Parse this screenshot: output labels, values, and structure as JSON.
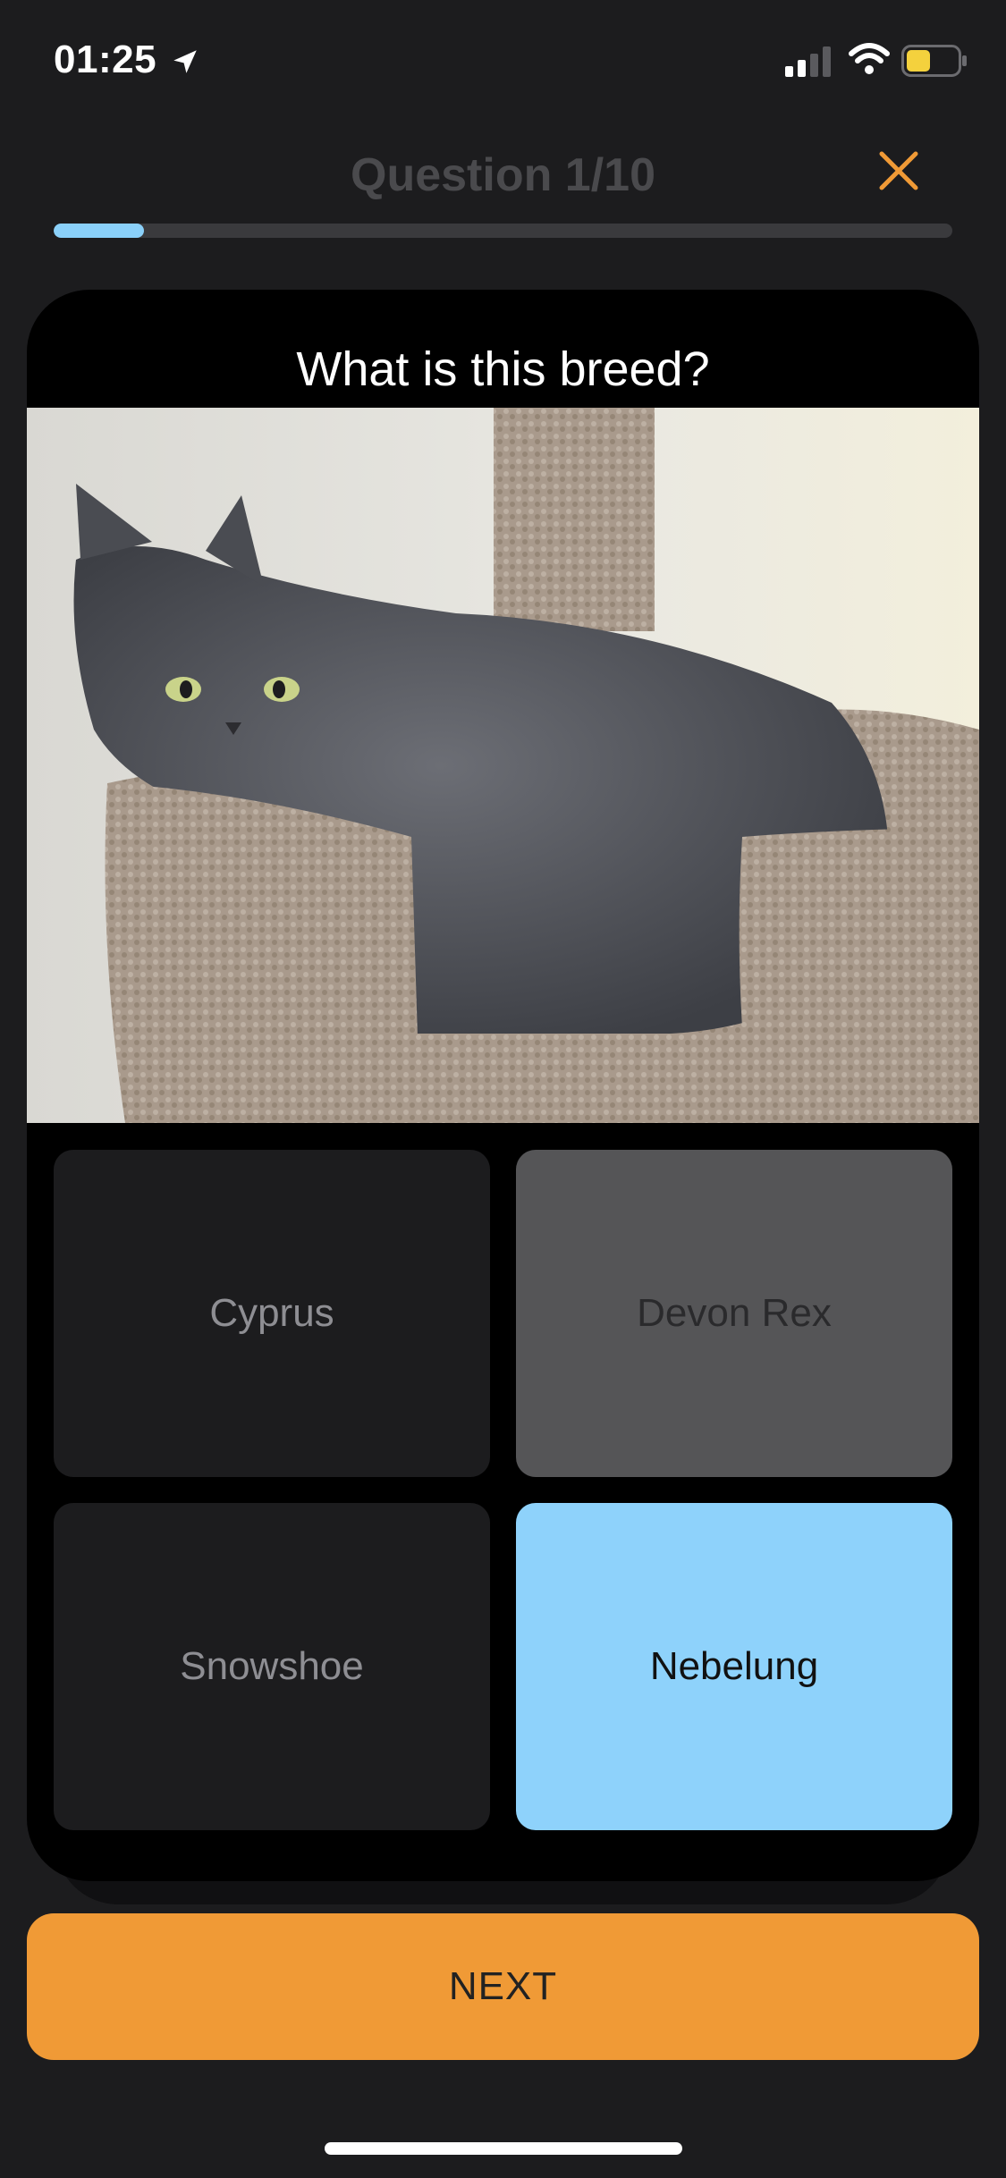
{
  "status_bar": {
    "time": "01:25",
    "location_icon": "location-arrow-icon",
    "signal_icon": "cellular-signal-icon",
    "wifi_icon": "wifi-icon",
    "battery_icon": "battery-icon"
  },
  "header": {
    "title": "Question 1/10",
    "close_icon": "close-icon",
    "progress_fraction": 0.1,
    "progress_color": "#8ad0f9"
  },
  "card": {
    "question": "What is this breed?",
    "image_icon": "cat-photo"
  },
  "answers": [
    {
      "label": "Cyprus",
      "state": "default"
    },
    {
      "label": "Devon Rex",
      "state": "disabled"
    },
    {
      "label": "Snowshoe",
      "state": "default"
    },
    {
      "label": "Nebelung",
      "state": "selected"
    }
  ],
  "footer": {
    "next_label": "NEXT",
    "accent": "#f09a36"
  }
}
